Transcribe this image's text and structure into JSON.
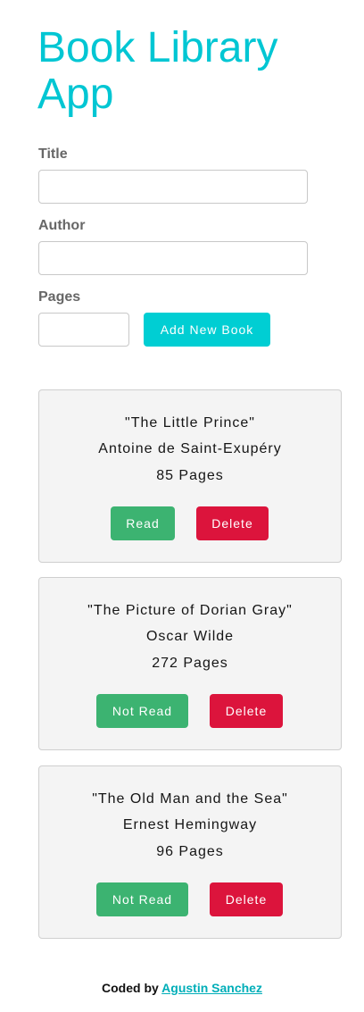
{
  "app": {
    "title": "Book Library App"
  },
  "form": {
    "title_label": "Title",
    "author_label": "Author",
    "pages_label": "Pages",
    "title_value": "",
    "author_value": "",
    "pages_value": "",
    "add_button_label": "Add New Book"
  },
  "books": [
    {
      "title": "\"The Little Prince\"",
      "author": "Antoine de Saint-Exupéry",
      "pages": "85 Pages",
      "status_button": "Read",
      "delete_button": "Delete"
    },
    {
      "title": "\"The Picture of Dorian Gray\"",
      "author": "Oscar Wilde",
      "pages": "272 Pages",
      "status_button": "Not Read",
      "delete_button": "Delete"
    },
    {
      "title": "\"The Old Man and the Sea\"",
      "author": "Ernest Hemingway",
      "pages": "96 Pages",
      "status_button": "Not Read",
      "delete_button": "Delete"
    }
  ],
  "footer": {
    "prefix": "Coded by",
    "author_link": "Agustin Sanchez"
  },
  "colors": {
    "accent": "#00c6d3",
    "read_button": "#3cb371",
    "delete_button": "#dc143c",
    "card_background": "#f4f4f4"
  }
}
